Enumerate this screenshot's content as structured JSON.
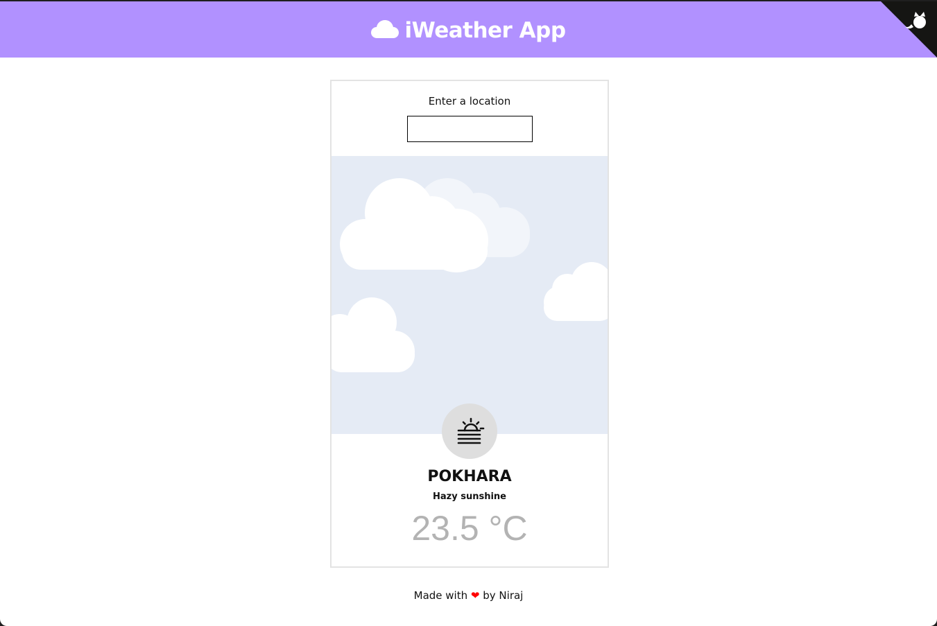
{
  "header": {
    "title": "iWeather App",
    "logo_icon": "cloud-icon",
    "corner_icon": "github-octocat-icon",
    "background": "#b191ff"
  },
  "search": {
    "label": "Enter a location",
    "value": "",
    "placeholder": ""
  },
  "weather": {
    "city": "POKHARA",
    "condition": "Hazy sunshine",
    "temperature": "23.5 °C",
    "icon": "hazy-sun-icon"
  },
  "footer": {
    "made_with": "Made with",
    "heart": "❤",
    "by": "by Niraj"
  },
  "colors": {
    "accent": "#b191ff",
    "sky": "#e5ebf5",
    "temperature": "#b3b3b3",
    "heart": "#ff0000"
  }
}
